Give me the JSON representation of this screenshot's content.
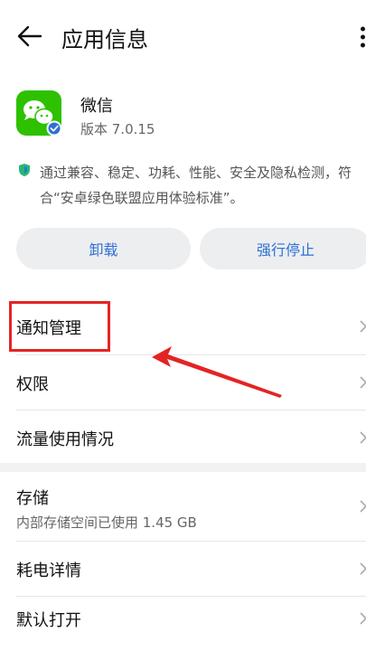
{
  "header": {
    "title": "应用信息"
  },
  "app": {
    "name": "微信",
    "version": "版本 7.0.15"
  },
  "security": {
    "text": "通过兼容、稳定、功耗、性能、安全及隐私检测，符合“安卓绿色联盟应用体验标准”。"
  },
  "buttons": {
    "uninstall": "卸载",
    "force_stop": "强行停止"
  },
  "menu": {
    "notifications": "通知管理",
    "permissions": "权限",
    "data_usage": "流量使用情况",
    "storage": "存储",
    "storage_detail": "内部存储空间已使用 1.45 GB",
    "battery": "耗电详情",
    "default_open": "默认打开"
  },
  "colors": {
    "accent": "#2f6fd6",
    "annotation": "#e32424",
    "brand_green": "#2dc100"
  }
}
